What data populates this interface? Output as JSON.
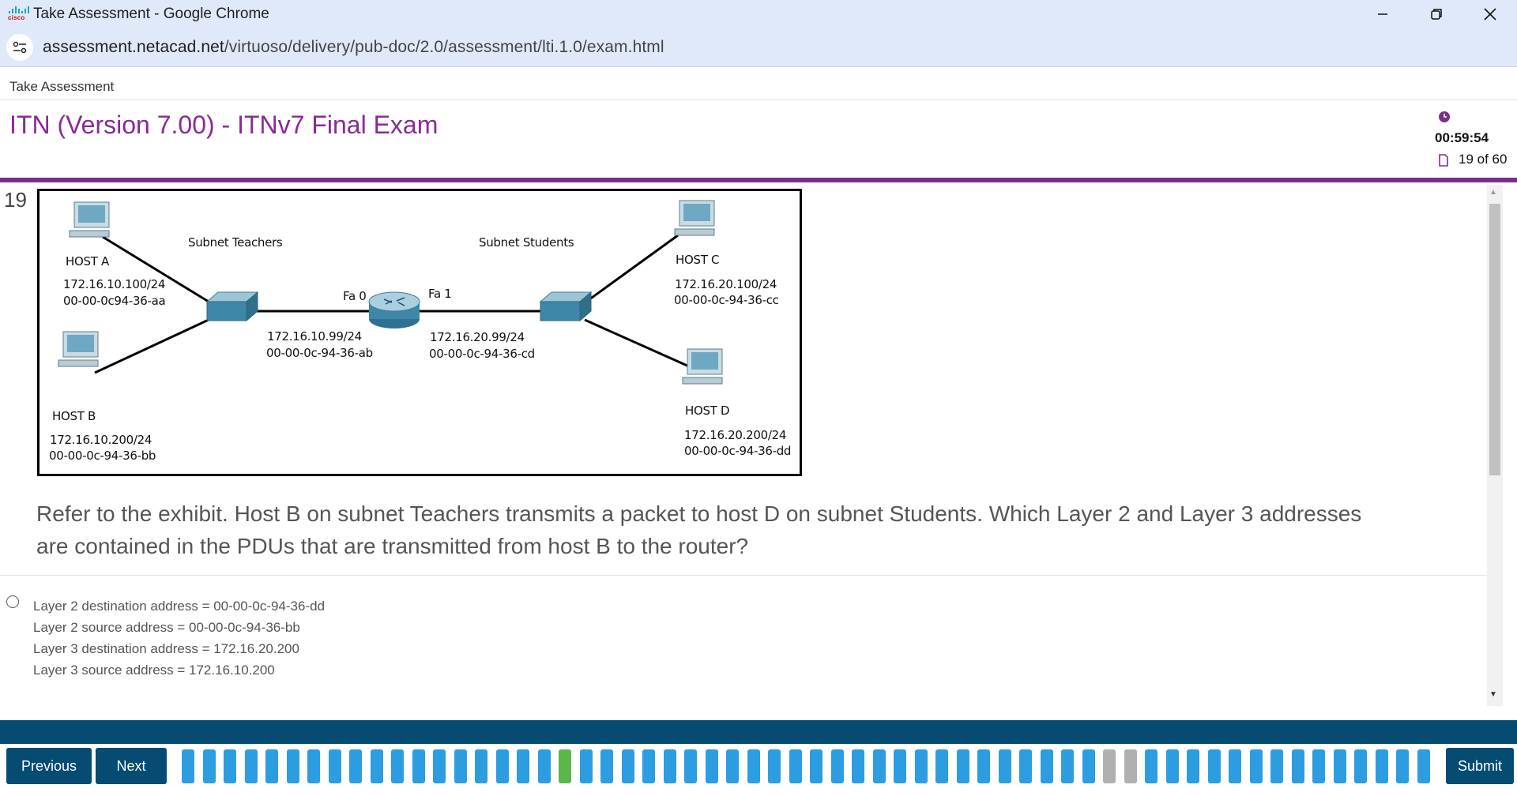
{
  "window": {
    "title": "Take Assessment - Google Chrome",
    "logo_text": "cisco"
  },
  "browser": {
    "url_host": "assessment.netacad.net",
    "url_path": "/virtuoso/delivery/pub-doc/2.0/assessment/lti.1.0/exam.html"
  },
  "header": {
    "breadcrumb": "Take Assessment",
    "exam_title": "ITN (Version 7.00) - ITNv7 Final Exam",
    "timer": "00:59:54",
    "progress": "19 of 60"
  },
  "question": {
    "number": "19",
    "text": "Refer to the exhibit. Host B on subnet Teachers transmits a packet to host D on subnet Students. Which Layer 2 and Layer 3 addresses are contained in the PDUs that are transmitted from host B to the router?",
    "options": [
      {
        "lines": [
          "Layer 2 destination address = 00-00-0c-94-36-dd",
          "Layer 2 source address = 00-00-0c-94-36-bb",
          "Layer 3 destination address = 172.16.20.200",
          "Layer 3 source address = 172.16.10.200"
        ]
      }
    ]
  },
  "exhibit": {
    "subnet_teachers": "Subnet Teachers",
    "subnet_students": "Subnet Students",
    "host_a": {
      "name": "HOST A",
      "ip": "172.16.10.100/24",
      "mac": "00-00-0c94-36-aa"
    },
    "host_b": {
      "name": "HOST B",
      "ip": "172.16.10.200/24",
      "mac": "00-00-0c-94-36-bb"
    },
    "host_c": {
      "name": "HOST C",
      "ip": "172.16.20.100/24",
      "mac": "00-00-0c-94-36-cc"
    },
    "host_d": {
      "name": "HOST D",
      "ip": "172.16.20.200/24",
      "mac": "00-00-0c-94-36-dd"
    },
    "router_fa0": {
      "label": "Fa 0",
      "ip": "172.16.10.99/24",
      "mac": "00-00-0c-94-36-ab"
    },
    "router_fa1": {
      "label": "Fa 1",
      "ip": "172.16.20.99/24",
      "mac": "00-00-0c-94-36-cd"
    }
  },
  "footer": {
    "previous_label": "Previous",
    "next_label": "Next",
    "submit_label": "Submit",
    "question_count": 60,
    "current_question": 19,
    "skipped_questions": [
      45,
      46
    ]
  },
  "colors": {
    "accent_purple": "#8a2a97",
    "nav_blue": "#054b72",
    "question_box": "#2d9de1",
    "current_box": "#5ab849",
    "skipped_box": "#b0b0b0"
  }
}
